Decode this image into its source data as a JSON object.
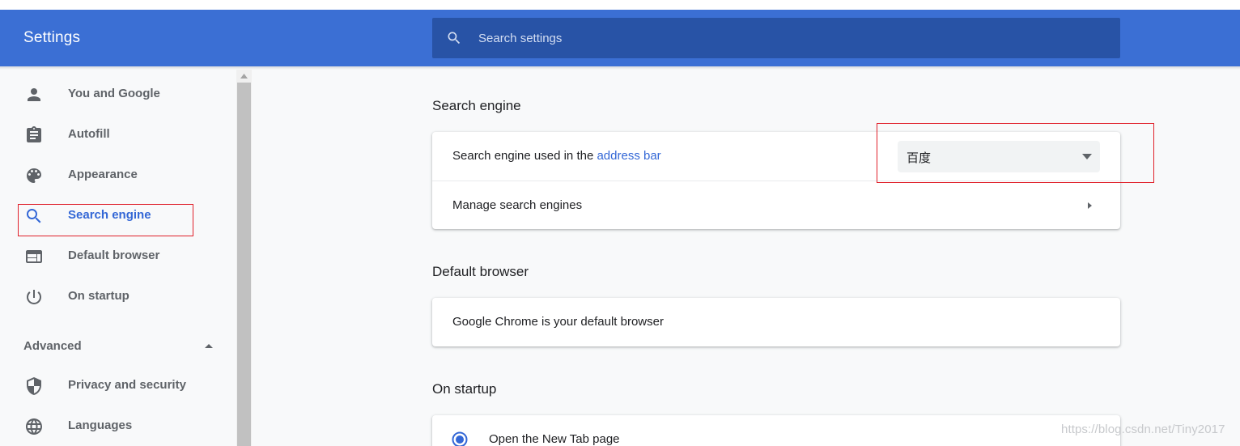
{
  "app": {
    "title": "Settings"
  },
  "search": {
    "placeholder": "Search settings",
    "icon": "search-icon"
  },
  "sidebar": {
    "items": [
      {
        "label": "You and Google",
        "icon": "person-icon"
      },
      {
        "label": "Autofill",
        "icon": "clipboard-icon"
      },
      {
        "label": "Appearance",
        "icon": "palette-icon"
      },
      {
        "label": "Search engine",
        "icon": "search-icon",
        "active": true
      },
      {
        "label": "Default browser",
        "icon": "browser-window-icon"
      },
      {
        "label": "On startup",
        "icon": "power-icon"
      }
    ],
    "advanced": {
      "label": "Advanced",
      "expanded": true
    },
    "advanced_items": [
      {
        "label": "Privacy and security",
        "icon": "shield-icon"
      },
      {
        "label": "Languages",
        "icon": "globe-icon"
      }
    ]
  },
  "sections": {
    "search_engine": {
      "title": "Search engine",
      "used_in_prefix": "Search engine used in the ",
      "used_in_link": "address bar",
      "selected_engine": "百度",
      "manage_label": "Manage search engines"
    },
    "default_browser": {
      "title": "Default browser",
      "status": "Google Chrome is your default browser"
    },
    "on_startup": {
      "title": "On startup",
      "option_new_tab": "Open the New Tab page",
      "option_new_tab_checked": true
    }
  },
  "watermark": "https://blog.csdn.net/Tiny2017",
  "colors": {
    "header": "#3b6fd4",
    "search_box": "#2853a6",
    "accent": "#3367d6",
    "highlight_box": "#e0212b"
  }
}
